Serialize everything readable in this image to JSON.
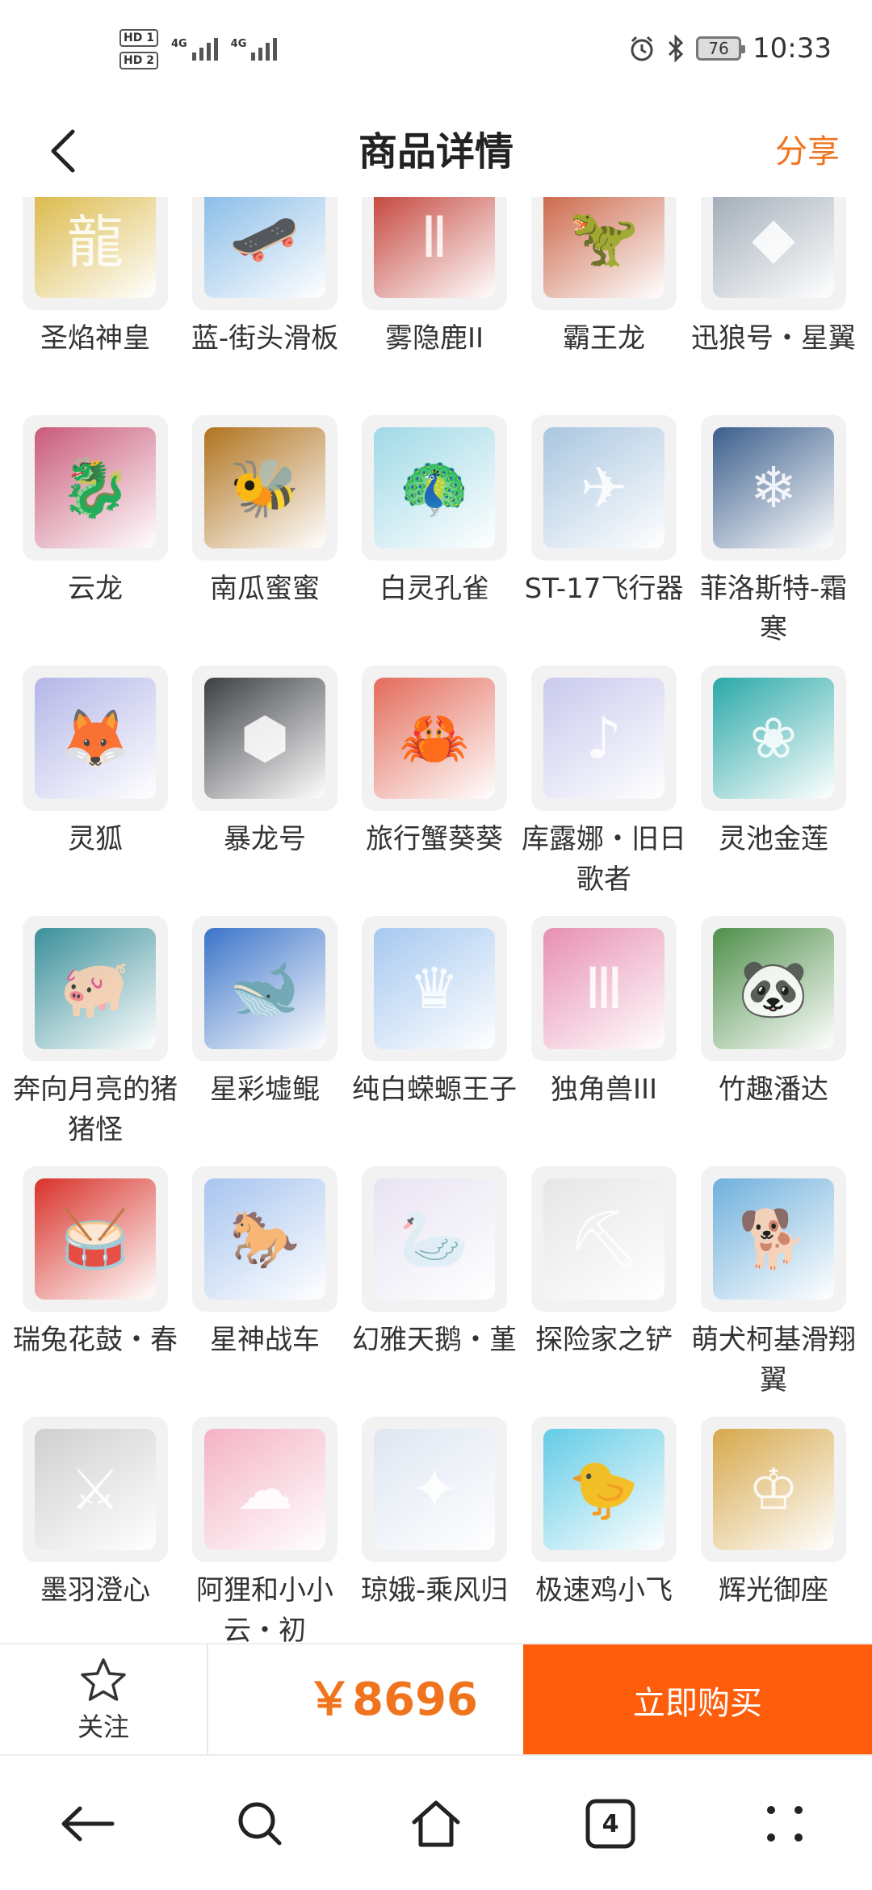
{
  "status_bar": {
    "hd1": "HD 1",
    "hd2": "HD 2",
    "network1": "4G",
    "network2": "4G",
    "battery": "76",
    "time": "10:33"
  },
  "header": {
    "title": "商品详情",
    "share": "分享"
  },
  "items": [
    {
      "name": "圣焰神皇",
      "icon": "golden-dragon",
      "color": "#d8b43a",
      "glyph": "龍"
    },
    {
      "name": "蓝-街头滑板",
      "icon": "skateboard",
      "color": "#7fb7e6",
      "glyph": "🛹"
    },
    {
      "name": "雾隐鹿II",
      "icon": "red-deer",
      "color": "#c0362c",
      "glyph": "Ⅱ"
    },
    {
      "name": "霸王龙",
      "icon": "t-rex",
      "color": "#c75a3a",
      "glyph": "🦖"
    },
    {
      "name": "迅狼号・星翼",
      "icon": "mech-wolf",
      "color": "#9aa6b2",
      "glyph": "◆"
    },
    {
      "name": "云龙",
      "icon": "cloud-dragon",
      "color": "#c95a7a",
      "glyph": "🐉"
    },
    {
      "name": "南瓜蜜蜜",
      "icon": "pumpkin-bee",
      "color": "#b0731f",
      "glyph": "🐝"
    },
    {
      "name": "白灵孔雀",
      "icon": "white-peacock",
      "color": "#9fd9e6",
      "glyph": "🦚"
    },
    {
      "name": "ST-17飞行器",
      "icon": "aircraft",
      "color": "#a9c6e0",
      "glyph": "✈"
    },
    {
      "name": "菲洛斯特-霜寒",
      "icon": "frost-beast",
      "color": "#3b5e8c",
      "glyph": "❄"
    },
    {
      "name": "灵狐",
      "icon": "spirit-fox",
      "color": "#b3b6e8",
      "glyph": "🦊"
    },
    {
      "name": "暴龙号",
      "icon": "black-mech",
      "color": "#3d3f44",
      "glyph": "⬢"
    },
    {
      "name": "旅行蟹葵葵",
      "icon": "crab",
      "color": "#e36b5a",
      "glyph": "🦀"
    },
    {
      "name": "库露娜・旧日歌者",
      "icon": "singer",
      "color": "#c9c9ee",
      "glyph": "♪"
    },
    {
      "name": "灵池金莲",
      "icon": "golden-lotus",
      "color": "#2aa8a8",
      "glyph": "❀"
    },
    {
      "name": "奔向月亮的猪猪怪",
      "icon": "pig",
      "color": "#3a8f9a",
      "glyph": "🐖"
    },
    {
      "name": "星彩墟鲲",
      "icon": "whale",
      "color": "#3b74c9",
      "glyph": "🐋"
    },
    {
      "name": "纯白蝾螈王子",
      "icon": "axolotl",
      "color": "#a6c8f0",
      "glyph": "♛"
    },
    {
      "name": "独角兽III",
      "icon": "unicorn",
      "color": "#e78fb2",
      "glyph": "Ⅲ"
    },
    {
      "name": "竹趣潘达",
      "icon": "panda",
      "color": "#4f8f4a",
      "glyph": "🐼"
    },
    {
      "name": "瑞兔花鼓・春",
      "icon": "drum",
      "color": "#d8322a",
      "glyph": "🥁"
    },
    {
      "name": "星神战车",
      "icon": "star-horse",
      "color": "#a7c4ef",
      "glyph": "🐎"
    },
    {
      "name": "幻雅天鹅・堇",
      "icon": "swan",
      "color": "#e8e3f2",
      "glyph": "🦢"
    },
    {
      "name": "探险家之铲",
      "icon": "shovel",
      "color": "#e6e6e6",
      "glyph": "⛏"
    },
    {
      "name": "萌犬柯基滑翔翼",
      "icon": "corgi",
      "color": "#6fb0dc",
      "glyph": "🐕"
    },
    {
      "name": "墨羽澄心",
      "icon": "feather-sword",
      "color": "#cfcfcf",
      "glyph": "⚔"
    },
    {
      "name": "阿狸和小小云・初",
      "icon": "fox-cloud",
      "color": "#f4b2c4",
      "glyph": "☁"
    },
    {
      "name": "琼娥-乘风归",
      "icon": "fairy",
      "color": "#dfe6f2",
      "glyph": "✦"
    },
    {
      "name": "极速鸡小飞",
      "icon": "blue-chick",
      "color": "#62cbe6",
      "glyph": "🐤"
    },
    {
      "name": "辉光御座",
      "icon": "throne",
      "color": "#d6a84b",
      "glyph": "♔"
    }
  ],
  "action_bar": {
    "follow_label": "关注",
    "price": "￥8696",
    "buy_label": "立即购买"
  },
  "nav_bar": {
    "tab_count": "4"
  }
}
